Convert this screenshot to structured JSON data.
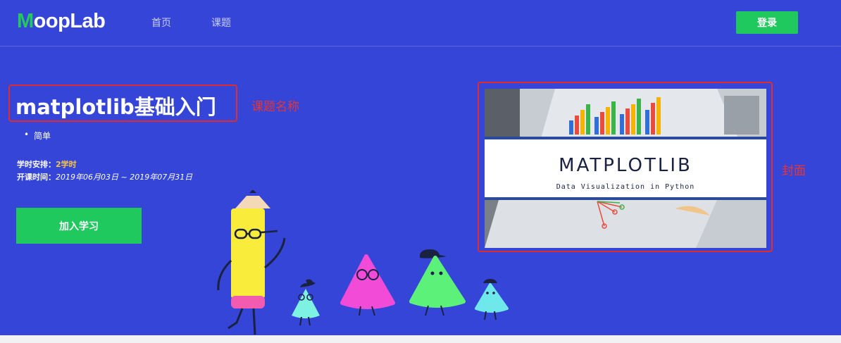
{
  "header": {
    "logo_first": "M",
    "logo_rest": "oopLab",
    "nav": [
      "首页",
      "课题"
    ],
    "login_label": "登录"
  },
  "course": {
    "title": "matplotlib基础入门",
    "level": "简单",
    "hours_label": "学时安排：",
    "hours_value": "2学时",
    "period_label": "开课时间：",
    "period_value": "2019年06月03日 ~ 2019年07月31日",
    "join_label": "加入学习"
  },
  "annotations": {
    "name_label": "课题名称",
    "cover_label": "封面"
  },
  "cover": {
    "title": "MATPLOTLIB",
    "subtitle": "Data Visualization in Python"
  },
  "colors": {
    "background": "#3545d8",
    "accent_green": "#1fc95e",
    "annotation_red": "#e02c2c",
    "hours_highlight": "#f5c542"
  }
}
